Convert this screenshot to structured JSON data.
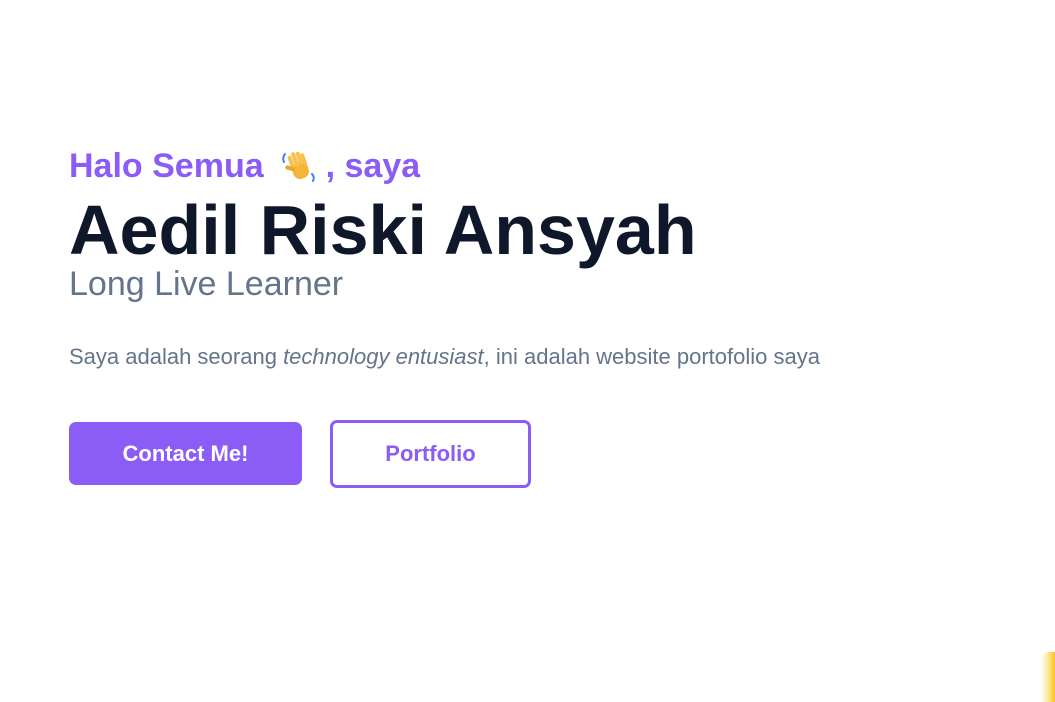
{
  "hero": {
    "greeting_prefix": "Halo Semua",
    "wave_icon": "waving-hand-icon",
    "greeting_suffix": ", saya",
    "name": "Aedil Riski Ansyah",
    "role": "Long Live Learner",
    "description": {
      "before": "Saya adalah seorang ",
      "emphasis": "technology entusiast",
      "after": ", ini adalah website portofolio saya"
    }
  },
  "actions": {
    "contact_label": "Contact Me!",
    "portfolio_label": "Portfolio"
  },
  "colors": {
    "accent": "#8b5cf6",
    "heading": "#0f172a",
    "muted": "#64748b",
    "background": "#ffffff"
  }
}
